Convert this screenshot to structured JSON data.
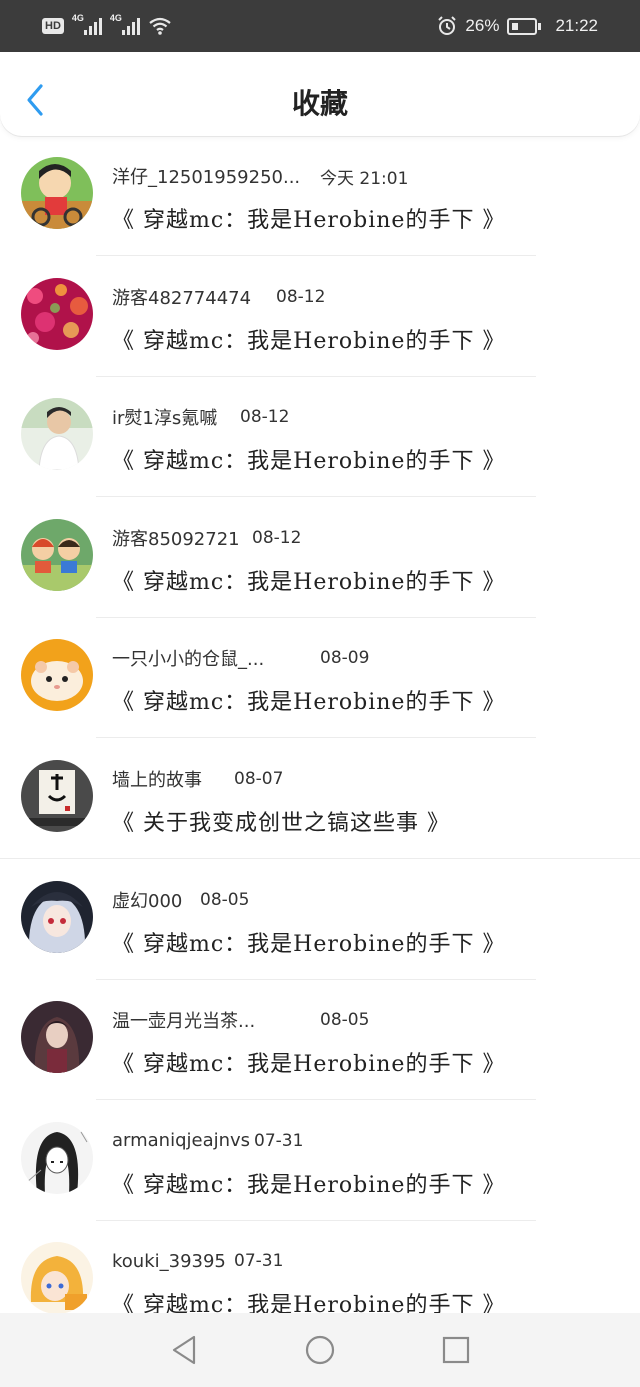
{
  "status": {
    "hd": "HD",
    "net1": "4G",
    "net2": "4G",
    "battery_pct": "26%",
    "time": "21:22"
  },
  "header": {
    "title": "收藏"
  },
  "items": [
    {
      "user": "洋仔_12501959250...",
      "time": "今天 21:01",
      "title": "《 穿越mc：我是Herobine的手下 》",
      "avatar": "cartoon-kid-avatar"
    },
    {
      "user": "游客482774474",
      "time": "08-12",
      "title": "《 穿越mc：我是Herobine的手下 》",
      "avatar": "bokeh-lights-avatar"
    },
    {
      "user": "ir熨1淳s氪嘁",
      "time": "08-12",
      "title": "《 穿越mc：我是Herobine的手下 》",
      "avatar": "young-man-avatar"
    },
    {
      "user": "游客85092721",
      "time": "08-12",
      "title": "《 穿越mc：我是Herobine的手下 》",
      "avatar": "anime-kids-avatar"
    },
    {
      "user": "一只小小的仓鼠_...",
      "time": "08-09",
      "title": "《 穿越mc：我是Herobine的手下 》",
      "avatar": "hamster-avatar"
    },
    {
      "user": "墙上的故事",
      "time": "08-07",
      "title": "《 关于我变成创世之镐这些事 》",
      "avatar": "calligraphy-avatar"
    },
    {
      "user": "虚幻000",
      "time": "08-05",
      "title": "《 穿越mc：我是Herobine的手下 》",
      "avatar": "anime-girl-avatar"
    },
    {
      "user": "温一壶月光当茶...",
      "time": "08-05",
      "title": "《 穿越mc：我是Herobine的手下 》",
      "avatar": "dark-anime-avatar"
    },
    {
      "user": "armaniqjeajnvs",
      "time": "07-31",
      "title": "《 穿越mc：我是Herobine的手下 》",
      "avatar": "sketch-girl-avatar"
    },
    {
      "user": "kouki_39395",
      "time": "07-31",
      "title": "《 穿越mc：我是Herobine的手下 》",
      "avatar": "blonde-anime-avatar"
    }
  ],
  "colors": {
    "accent": "#2f9cf0",
    "status_bar": "#3c3c3c",
    "nav_bar": "#f4f4f4"
  }
}
